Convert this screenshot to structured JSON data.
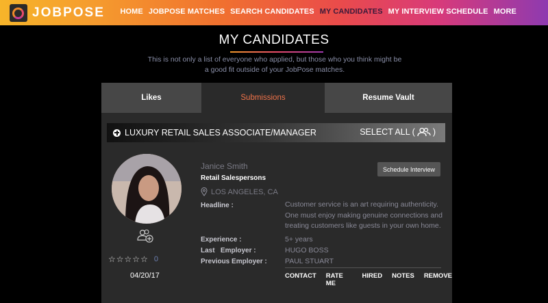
{
  "header": {
    "logo_text": "JOBPOSE",
    "nav": [
      {
        "label": "HOME",
        "active": false
      },
      {
        "label": "JOBPOSE MATCHES",
        "active": false
      },
      {
        "label": "SEARCH CANDIDATES",
        "active": false
      },
      {
        "label": "MY CANDIDATES",
        "active": true
      },
      {
        "label": "MY INTERVIEW SCHEDULE",
        "active": false
      },
      {
        "label": "MORE",
        "active": false
      }
    ]
  },
  "page": {
    "title": "MY CANDIDATES",
    "subtitle": "This is not only a list of everyone who applied, but those who you think might be a good fit outside of your JobPose matches."
  },
  "tabs": [
    {
      "label": "Likes"
    },
    {
      "label": "Submissions",
      "selected": true
    },
    {
      "label": "Resume Vault"
    }
  ],
  "job": {
    "title": "LUXURY RETAIL SALES ASSOCIATE/MANAGER",
    "select_all_label": "SELECT ALL (",
    "select_all_close": ")"
  },
  "candidate": {
    "name": "Janice Smith",
    "role": "Retail Salespersons",
    "location": "LOS ANGELES, CA",
    "schedule_button": "Schedule Interview",
    "rating_count": "0",
    "date": "04/20/17",
    "fields": {
      "headline_label": "Headline :",
      "headline_value": "Customer service is an art requiring authenticity. One must enjoy making genuine connections and treating customers like guests in your own home.",
      "experience_label": "Experience :",
      "experience_value": "5+ years",
      "last_employer_label": "Last   Employer :",
      "last_employer_value": "HUGO BOSS",
      "previous_employer_label": "Previous Employer :",
      "previous_employer_value": "PAUL STUART"
    },
    "actions": [
      "CONTACT",
      "RATE ME",
      "HIRED",
      "NOTES",
      "REMOVE"
    ]
  },
  "colors": {
    "accent": "#f0734a",
    "panel": "#2a2a2a",
    "tab_inactive": "#474747"
  }
}
